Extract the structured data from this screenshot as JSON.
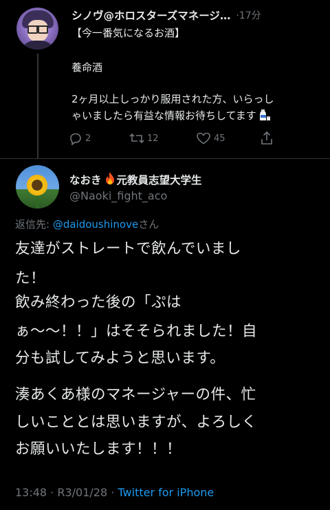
{
  "reply_parent": {
    "display_name": "シノヴ@ホロスターズマネージ…",
    "time": "·17分",
    "lines": [
      "【今一番気になるお酒】",
      "養命酒",
      "2ヶ月以上しっかり服用された方、いらっし",
      "ゃいましたら有益な情報お待ちしてます"
    ],
    "emoji": "sake-bottle",
    "actions": {
      "reply_count": "2",
      "retweet_count": "12",
      "like_count": "45"
    }
  },
  "main_tweet": {
    "display_name": "なおき",
    "display_name_rest": "元教員志望大学生",
    "handle": "@Naoki_fight_aco",
    "reply_prefix": "返信先: ",
    "reply_mention": "@daidoushinove",
    "reply_suffix": "さん",
    "lines": [
      "友達がストレートで飲んでいまし",
      "た！",
      "飲み終わった後の「ぷは",
      "ぁ〜〜！！」はそそられました！自",
      "分も試してみようと思います。",
      "湊あくあ様のマネージャーの件、忙",
      "しいこととは思いますが、よろしく",
      "お願いいたします！！！"
    ],
    "meta_time": "13:48 · R3/01/28 · ",
    "meta_source": "Twitter for iPhone"
  },
  "colors": {
    "background": "#000000",
    "text": "#e7e9ea",
    "muted": "#71767b",
    "link": "#1d9bf0"
  }
}
